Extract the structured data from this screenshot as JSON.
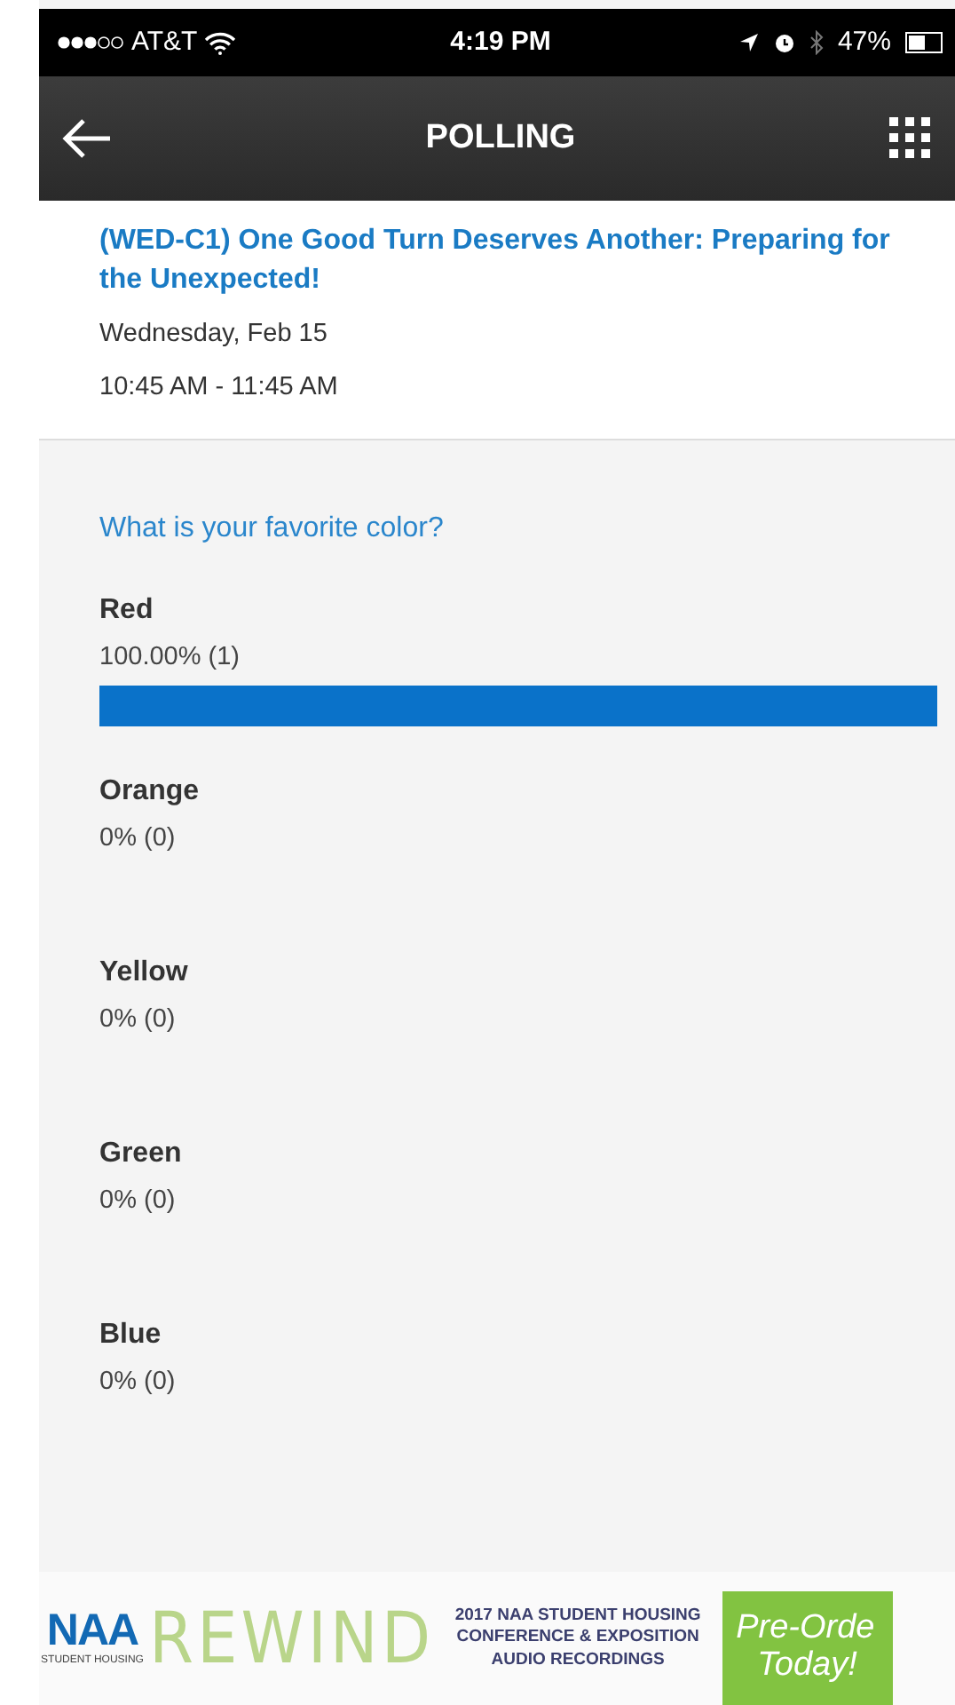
{
  "status_bar": {
    "carrier": "AT&T",
    "time": "4:19 PM",
    "battery": "47%"
  },
  "header": {
    "title": "POLLING"
  },
  "session": {
    "title": "(WED-C1) One Good Turn Deserves Another: Preparing for the Unexpected!",
    "date": "Wednesday, Feb 15",
    "time": "10:45 AM - 11:45 AM"
  },
  "poll": {
    "question": "What is your favorite color?",
    "options": [
      {
        "kind": "bar",
        "label": "Red",
        "result": "100.00% (1)"
      },
      {
        "kind": "text",
        "label": "Orange",
        "result": "0% (0)"
      },
      {
        "kind": "text",
        "label": "Yellow",
        "result": "0% (0)"
      },
      {
        "kind": "text",
        "label": "Green",
        "result": "0% (0)"
      },
      {
        "kind": "text",
        "label": "Blue",
        "result": "0% (0)"
      }
    ]
  },
  "banner": {
    "logo": "NAA",
    "logo_sub": "STUDENT HOUSING",
    "product": "REWIND",
    "headline": "2017 NAA STUDENT HOUSING CONFERENCE & EXPOSITION AUDIO RECORDINGS",
    "cta": "Pre-Orde",
    "cta_line2": "Today!"
  }
}
